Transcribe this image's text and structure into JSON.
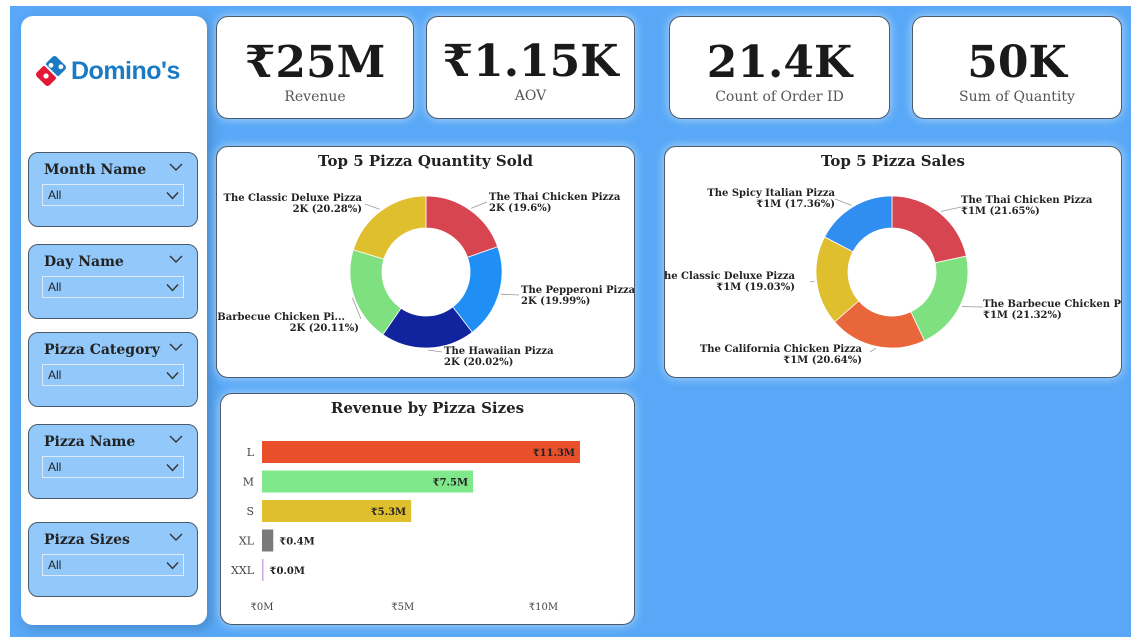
{
  "brand": {
    "name": "Domino's",
    "colors": {
      "blue": "#1a7bc4",
      "red": "#e31837"
    }
  },
  "theme": {
    "background": "#58a8f7",
    "slicer_bg": "#93c8fa"
  },
  "slicers": [
    {
      "title": "Month Name",
      "value": "All"
    },
    {
      "title": "Day Name",
      "value": "All"
    },
    {
      "title": "Pizza Category",
      "value": "All"
    },
    {
      "title": "Pizza Name",
      "value": "All"
    },
    {
      "title": "Pizza Sizes",
      "value": "All"
    }
  ],
  "kpis": [
    {
      "value": "₹25M",
      "label": "Revenue"
    },
    {
      "value": "₹1.15K",
      "label": "AOV"
    },
    {
      "value": "21.4K",
      "label": "Count of Order ID"
    },
    {
      "value": "50K",
      "label": "Sum of Quantity"
    }
  ],
  "chart_data": [
    {
      "type": "pie",
      "donut": true,
      "title": "Top 5 Pizza Quantity Sold",
      "slices": [
        {
          "name": "The Thai Chicken Pizza",
          "value": 19.6,
          "label": "2K (19.6%)",
          "color": "#d64550"
        },
        {
          "name": "The Pepperoni Pizza",
          "value": 19.99,
          "label": "2K (19.99%)",
          "color": "#1f8ef5"
        },
        {
          "name": "The Hawaiian Pizza",
          "value": 20.02,
          "label": "2K (20.02%)",
          "color": "#12239e"
        },
        {
          "name": "The Barbecue Chicken Pi...",
          "value": 20.11,
          "label": "2K (20.11%)",
          "color": "#7fe07f"
        },
        {
          "name": "The Classic Deluxe Pizza",
          "value": 20.28,
          "label": "2K (20.28%)",
          "color": "#e0bf2f"
        }
      ]
    },
    {
      "type": "pie",
      "donut": true,
      "title": "Top 5 Pizza Sales",
      "slices": [
        {
          "name": "The Thai Chicken Pizza",
          "value": 21.65,
          "label": "₹1M (21.65%)",
          "color": "#d64550"
        },
        {
          "name": "The Barbecue Chicken Pizza",
          "value": 21.32,
          "label": "₹1M (21.32%)",
          "color": "#7fe07f"
        },
        {
          "name": "The California Chicken Pizza",
          "value": 20.64,
          "label": "₹1M (20.64%)",
          "color": "#e8663a"
        },
        {
          "name": "The Classic Deluxe Pizza",
          "value": 19.03,
          "label": "₹1M (19.03%)",
          "color": "#e0bf2f"
        },
        {
          "name": "The Spicy Italian Pizza",
          "value": 17.36,
          "label": "₹1M (17.36%)",
          "color": "#2f8ef0"
        }
      ]
    },
    {
      "type": "bar",
      "orientation": "horizontal",
      "title": "Revenue by Pizza Sizes",
      "categories": [
        "L",
        "M",
        "S",
        "XL",
        "XXL"
      ],
      "values": [
        11.3,
        7.5,
        5.3,
        0.4,
        0.0
      ],
      "value_labels": [
        "₹11.3M",
        "₹7.5M",
        "₹5.3M",
        "₹0.4M",
        "₹0.0M"
      ],
      "colors": [
        "#e8502c",
        "#7fe88a",
        "#e0bf2f",
        "#7a7a7a",
        "#c9a8e8"
      ],
      "xlim": [
        0,
        11.3
      ],
      "xticks": [
        0,
        5,
        10
      ],
      "xtick_labels": [
        "₹0M",
        "₹5M",
        "₹10M"
      ]
    }
  ]
}
